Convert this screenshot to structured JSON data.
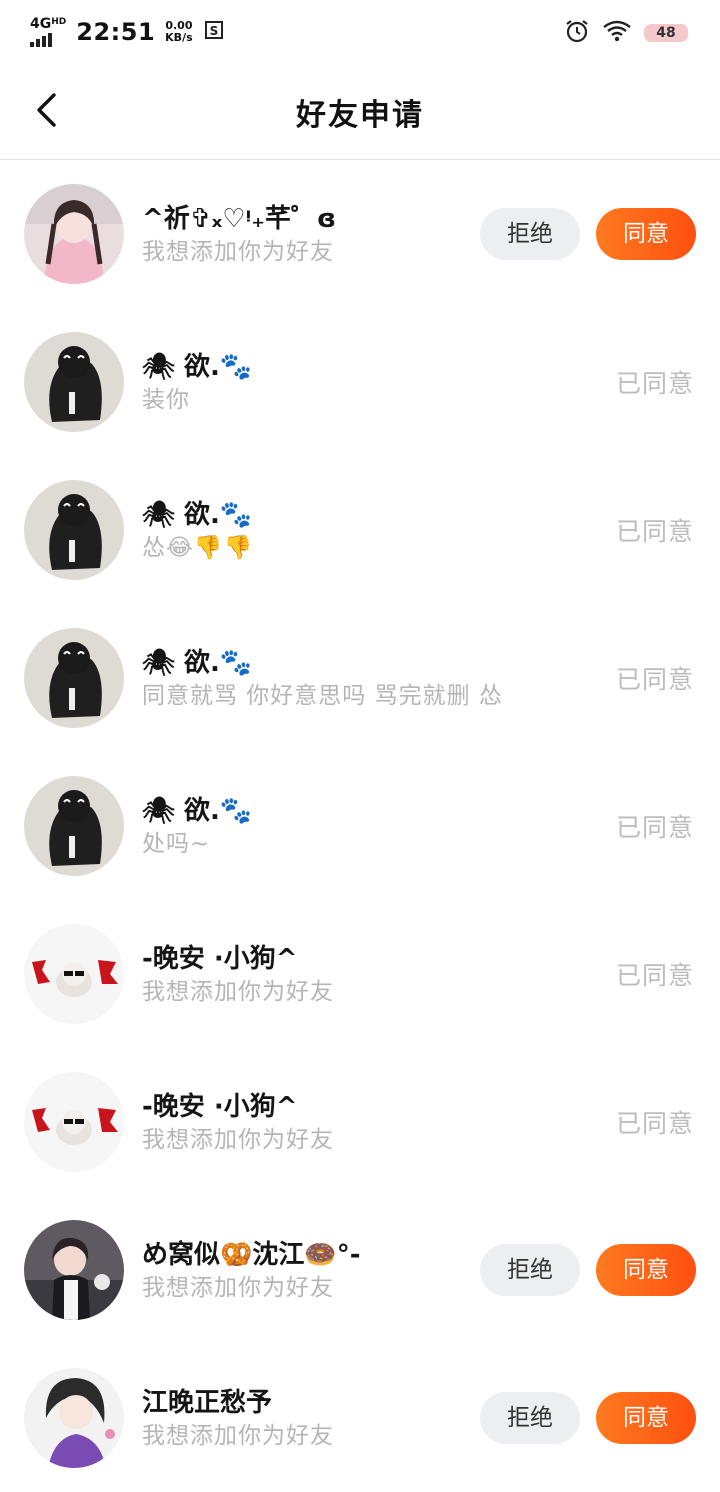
{
  "status_bar": {
    "network": "4G",
    "network_sup": "HD",
    "time": "22:51",
    "speed_value": "0.00",
    "speed_unit": "KB/s",
    "battery": "48"
  },
  "header": {
    "title": "好友申请"
  },
  "buttons": {
    "reject": "拒绝",
    "accept": "同意"
  },
  "requests": [
    {
      "name": "^祈✞ₓ♡ᵎ₊芊゜ɞ",
      "message": "我想添加你为好友",
      "status": "pending",
      "status_text": "",
      "avatar": "girl-pink"
    },
    {
      "name": "🕷 欲.🐾",
      "message": "装你",
      "status": "accepted",
      "status_text": "已同意",
      "avatar": "dark-figure"
    },
    {
      "name": "🕷 欲.🐾",
      "message": "怂😂👎👎",
      "status": "accepted",
      "status_text": "已同意",
      "avatar": "dark-figure"
    },
    {
      "name": "🕷 欲.🐾",
      "message": "同意就骂 你好意思吗 骂完就删 怂",
      "status": "accepted",
      "status_text": "已同意",
      "avatar": "dark-figure"
    },
    {
      "name": "🕷 欲.🐾",
      "message": "处吗~",
      "status": "accepted",
      "status_text": "已同意",
      "avatar": "dark-figure"
    },
    {
      "name": "-晚安 ·小狗^",
      "message": "我想添加你为好友",
      "status": "accepted",
      "status_text": "已同意",
      "avatar": "sheep"
    },
    {
      "name": "-晚安 ·小狗^",
      "message": "我想添加你为好友",
      "status": "accepted",
      "status_text": "已同意",
      "avatar": "sheep"
    },
    {
      "name": "め窝似🥨沈江🍩°-",
      "message": "我想添加你为好友",
      "status": "pending",
      "status_text": "",
      "avatar": "maid"
    },
    {
      "name": "江晚正愁予",
      "message": "我想添加你为好友",
      "status": "pending",
      "status_text": "",
      "avatar": "anime"
    }
  ],
  "colors": {
    "accept_bg": "#ff5c14",
    "reject_bg": "#eceef2",
    "muted_text": "#b5b5b5",
    "battery_bg": "#f4c9cc"
  },
  "icons": {
    "back": "chevron-left-icon",
    "alarm": "alarm-icon",
    "wifi": "wifi-icon",
    "signal": "signal-icon",
    "screenshot": "screenshot-icon"
  }
}
